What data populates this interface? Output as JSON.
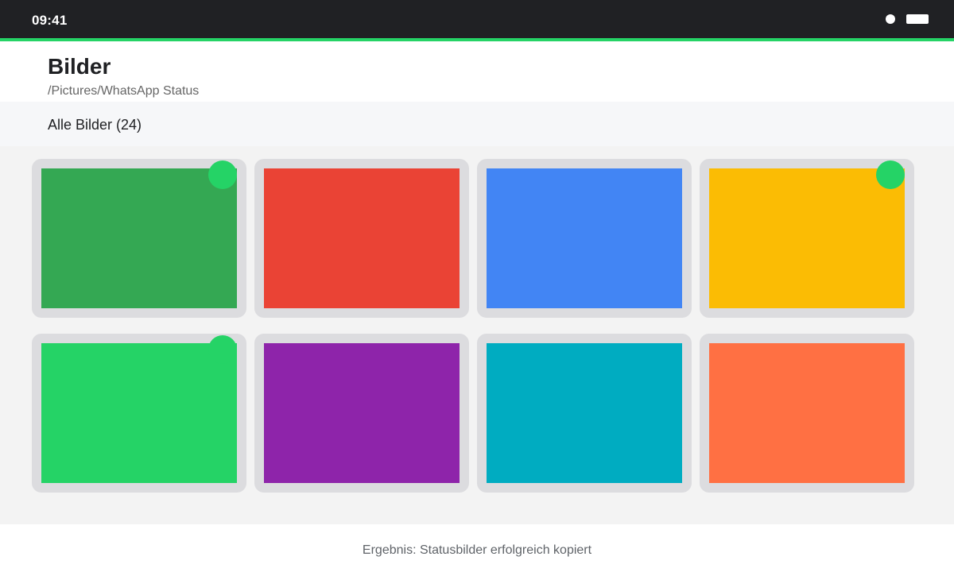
{
  "status_bar": {
    "time": "09:41",
    "icons": [
      "signal-dot-icon",
      "battery-icon"
    ]
  },
  "header": {
    "title": "Bilder",
    "path": "/Pictures/WhatsApp Status"
  },
  "filter": {
    "label": "Alle Bilder (24)"
  },
  "colors": {
    "accent": "#25d366",
    "status_bar_bg": "#202124"
  },
  "images": [
    {
      "color": "#34a853",
      "selected": true
    },
    {
      "color": "#ea4335",
      "selected": false
    },
    {
      "color": "#4285f4",
      "selected": false
    },
    {
      "color": "#fbbc04",
      "selected": true
    },
    {
      "color": "#25d366",
      "selected": true
    },
    {
      "color": "#8e24aa",
      "selected": false
    },
    {
      "color": "#00acc1",
      "selected": false
    },
    {
      "color": "#ff7043",
      "selected": false
    }
  ],
  "footer": {
    "result": "Ergebnis: Statusbilder erfolgreich kopiert"
  }
}
